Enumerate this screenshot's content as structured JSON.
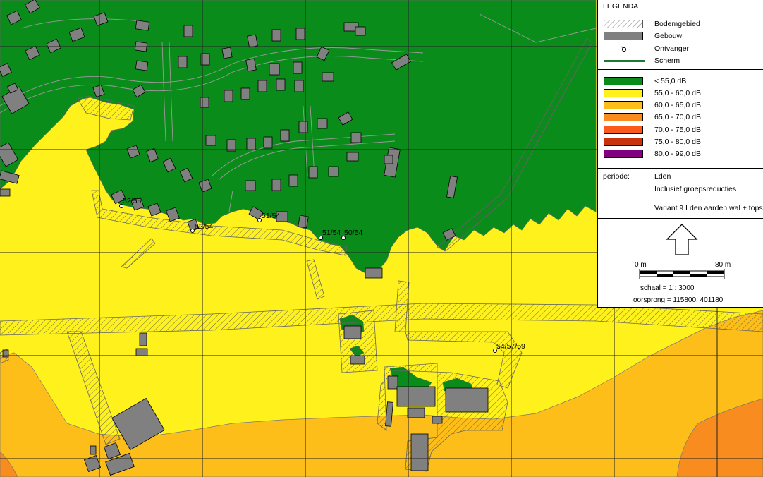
{
  "legend": {
    "title": "LEGENDA",
    "symbols": [
      {
        "label": "Bodemgebied",
        "kind": "hatch"
      },
      {
        "label": "Gebouw",
        "kind": "building",
        "color": "#808080"
      },
      {
        "label": "Ontvanger",
        "kind": "receiver-icon"
      },
      {
        "label": "Scherm",
        "kind": "line",
        "color": "#1a7a32"
      }
    ],
    "classes": [
      {
        "label": "< 55,0 dB",
        "color": "#0a8c1a"
      },
      {
        "label": "55,0 - 60,0 dB",
        "color": "#fff21c"
      },
      {
        "label": "60,0 - 65,0 dB",
        "color": "#fdbe1a"
      },
      {
        "label": "65,0 - 70,0 dB",
        "color": "#f98c1e"
      },
      {
        "label": "70,0 - 75,0 dB",
        "color": "#fb5a1c"
      },
      {
        "label": "75,0 - 80,0 dB",
        "color": "#c8320e"
      },
      {
        "label": "80,0 - 99,0 dB",
        "color": "#800080"
      }
    ],
    "period_label": "periode:",
    "period_value": "Lden",
    "period_note": "Inclusief groepsreducties",
    "variant": "Variant 9 Lden aarden wal + tops",
    "north_arrow": "north-arrow-icon",
    "scalebar_start": "0 m",
    "scalebar_end": "80 m",
    "scale": "schaal = 1 : 3000",
    "origin": "oorsprong = 115800, 401180"
  },
  "map": {
    "receiver_labels": [
      "52/55",
      "52/54",
      "51/54",
      "51/54",
      "50/54",
      "54/57/59"
    ]
  }
}
